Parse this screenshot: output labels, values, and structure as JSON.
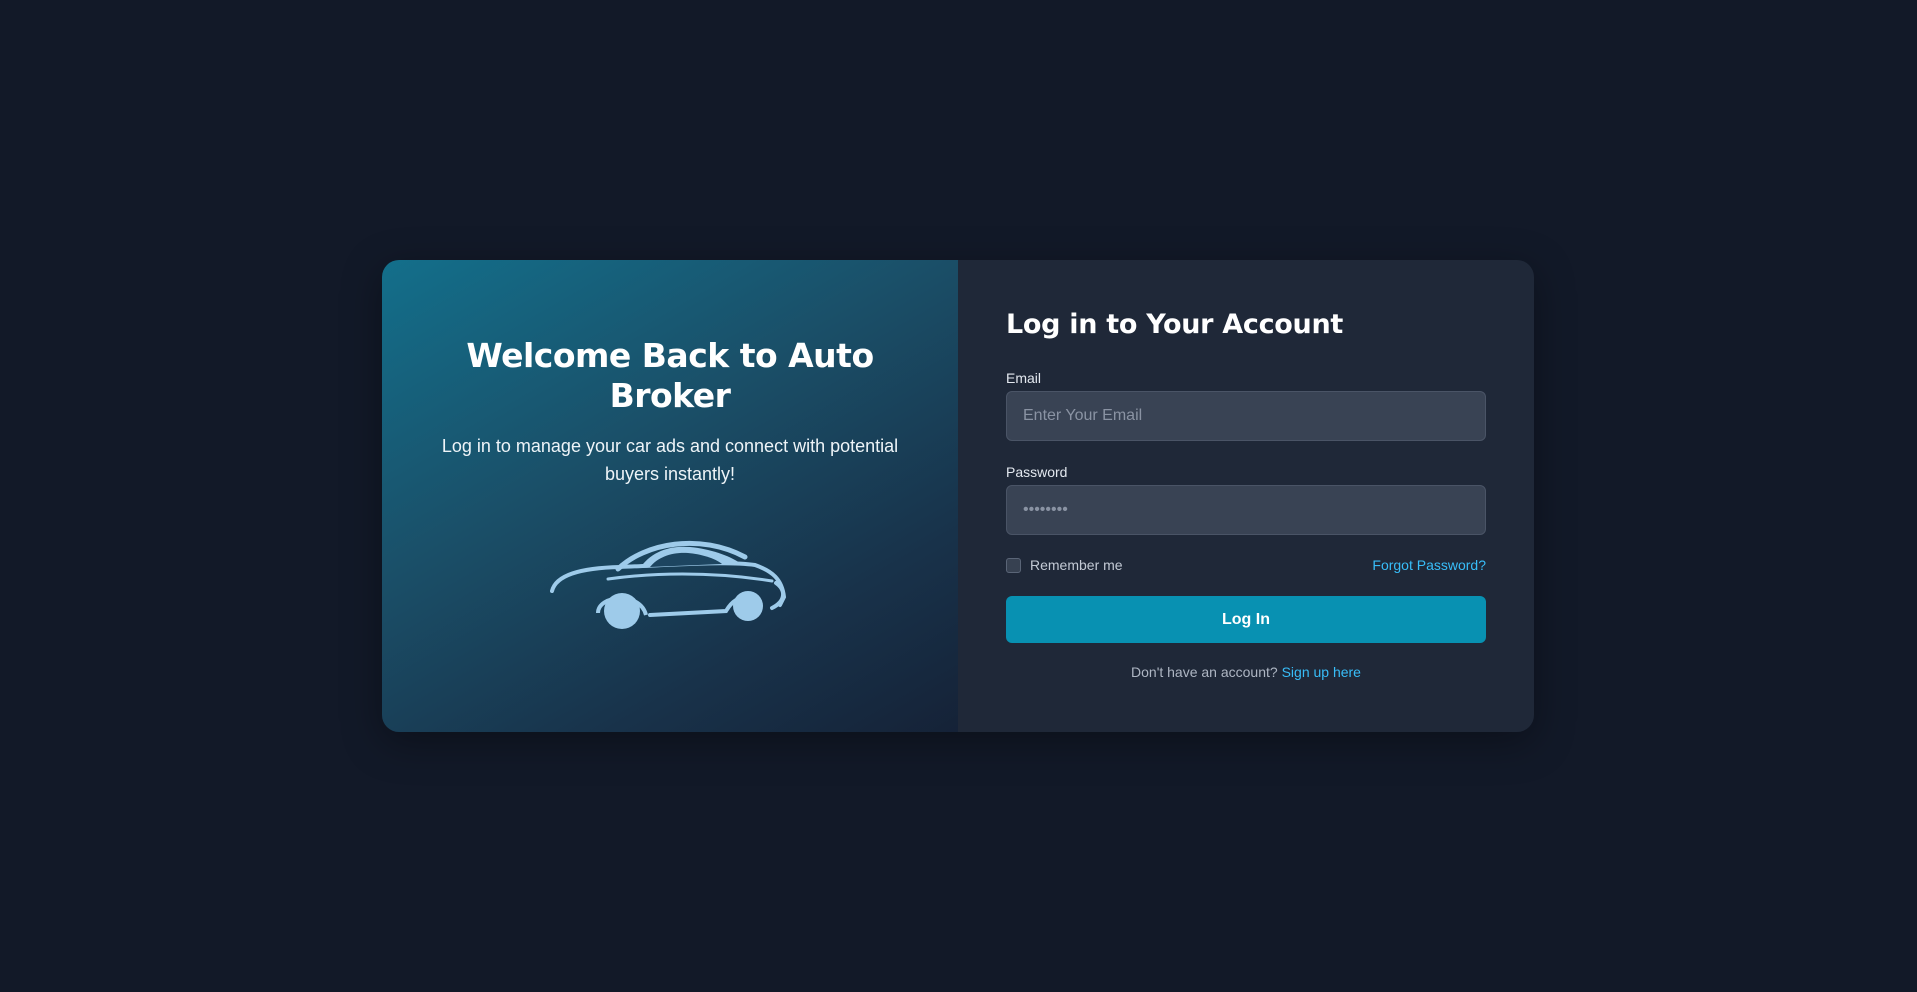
{
  "left_panel": {
    "title": "Welcome Back to Auto Broker",
    "subtitle": "Log in to manage your car ads and connect with potential buyers instantly!",
    "illustration_icon": "car-icon",
    "illustration_color": "#9ecbea"
  },
  "form": {
    "title": "Log in to Your Account",
    "email": {
      "label": "Email",
      "placeholder": "Enter Your Email",
      "value": ""
    },
    "password": {
      "label": "Password",
      "placeholder": "••••••••",
      "value": ""
    },
    "remember_me": {
      "label": "Remember me",
      "checked": false
    },
    "forgot_password": "Forgot Password?",
    "submit_label": "Log In",
    "signup_prompt": "Don't have an account?",
    "signup_link": "Sign up here"
  },
  "colors": {
    "page_background": "#121928",
    "form_background": "#1f2838",
    "accent": "#0891b2",
    "link": "#38bdf8"
  }
}
